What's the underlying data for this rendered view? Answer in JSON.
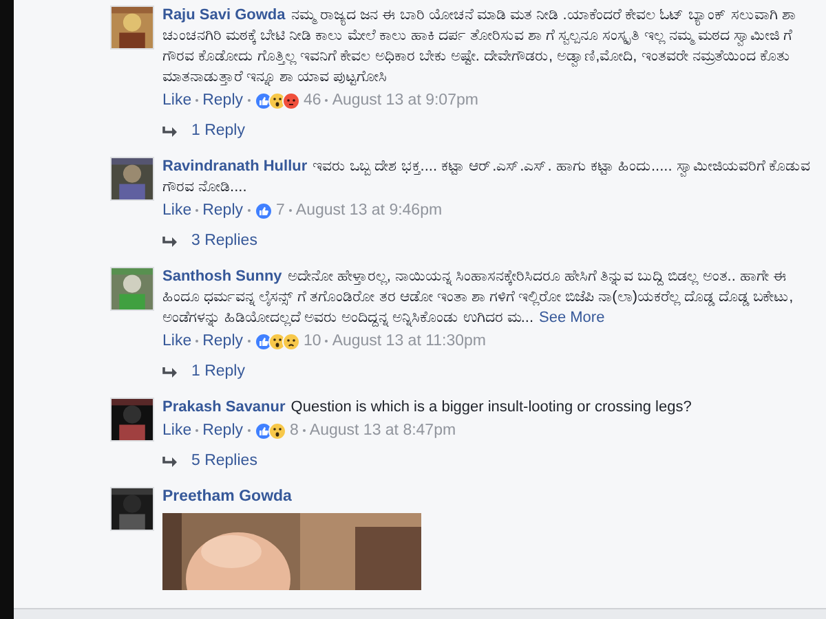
{
  "comments": [
    {
      "author": "Raju Savi Gowda",
      "text": "ನಮ್ಮ ರಾಜ್ಯದ ಜನ ಈ ಬಾರಿ ಯೋಚನೆ ಮಾಡಿ ಮತ ನೀಡಿ .ಯಾಕೆಂದರೆ ಕೇವಲ ಓಟ್ ಬ್ಯಾಂಕ್ ಸಲುವಾಗಿ ಶಾ ಚುಂಚನಗಿರಿ ಮಠಕ್ಕೆ ಬೇಟಿ ನೀಡಿ ಕಾಲು ಮೇಲೆ ಕಾಲು ಹಾಕಿ ದರ್ಪ ತೋರಿಸುವ ಶಾ ಗೆ ಸ್ವಲ್ಪನೂ ಸಂಸ್ಕೃತಿ ಇಲ್ಲ ನಮ್ಮ ಮಠದ ಸ್ವಾಮೀಜಿ ಗೆ ಗೌರವ ಕೊಡೋದು ಗೊತ್ತಿಲ್ಲ ಇವನಿಗೆ ಕೇವಲ ಅಧಿಕಾರ ಬೇಕು ಅಷ್ಟೇ. ದೇವೇಗೌಡರು, ಅಡ್ವಾಣಿ,ಮೋದಿ, ಇಂತವರೇ ನಮ್ರತೆಯಿಂದ ಕೊತು ಮಾತನಾಡುತ್ತಾರೆ ಇನ್ನೂ ಶಾ ಯಾವ ಪುಟ್ಟಗೋಸಿ",
      "like": "Like",
      "reply": "Reply",
      "reactions": [
        {
          "kind": "like"
        },
        {
          "kind": "wow"
        },
        {
          "kind": "angry"
        }
      ],
      "count": "46",
      "time": "August 13 at 9:07pm",
      "replies": "1 Reply"
    },
    {
      "author": "Ravindranath Hullur",
      "text": "ಇವರು ಒಬ್ಬ ದೇಶ ಭಕ್ತ.... ಕಟ್ಟಾ ಆರ್.ಎಸ್.ಎಸ್. ಹಾಗು ಕಟ್ಟಾ ಹಿಂದು..... ಸ್ವಾಮೀಜಿಯವರಿಗೆ ಕೊಡುವ ಗೌರವ ನೋಡಿ....",
      "like": "Like",
      "reply": "Reply",
      "reactions": [
        {
          "kind": "like"
        }
      ],
      "count": "7",
      "time": "August 13 at 9:46pm",
      "replies": "3 Replies"
    },
    {
      "author": "Santhosh Sunny",
      "text": "ಅದೇನೋ ಹೇಳ್ತಾರಲ್ಲ, ನಾಯಿಯನ್ನ ಸಿಂಹಾಸನಕ್ಕೇರಿಸಿದರೂ ಹೇಸಿಗೆ ತಿನ್ನುವ ಬುದ್ದಿ ಬಿಡಲ್ಲ ಅಂತ.. ಹಾಗೇ ಈ ಹಿಂದೂ ಧರ್ಮವನ್ನ ಲೈಸನ್ಸ್ ಗೆ ತಗೊಂಡಿರೋ ತರ ಆಡೋ ಇಂತಾ ಶಾ ಗಳಿಗೆ ಇಲ್ಲಿರೋ ಬಿಜೆಪಿ ನಾ(ಲಾ)ಯಕರೆಲ್ಲ ದೊಡ್ಡ ದೊಡ್ಡ ಬಕೇಟು, ಅಂಡೆಗಳನ್ನು ಹಿಡಿಯೋದಲ್ಲದೆ ಅವರು ಅಂದಿದ್ದನ್ನ ಅನ್ನಿಸಿಕೊಂಡು ಉಗಿದರ ಮ...",
      "see_more": "See More",
      "like": "Like",
      "reply": "Reply",
      "reactions": [
        {
          "kind": "like"
        },
        {
          "kind": "wow"
        },
        {
          "kind": "sad"
        }
      ],
      "count": "10",
      "time": "August 13 at 11:30pm",
      "replies": "1 Reply"
    },
    {
      "author": "Prakash Savanur",
      "text": "Question is which is a bigger insult-looting or crossing legs?",
      "like": "Like",
      "reply": "Reply",
      "reactions": [
        {
          "kind": "like"
        },
        {
          "kind": "wow"
        }
      ],
      "count": "8",
      "time": "August 13 at 8:47pm",
      "replies": "5 Replies"
    },
    {
      "author": "Preetham Gowda"
    }
  ]
}
